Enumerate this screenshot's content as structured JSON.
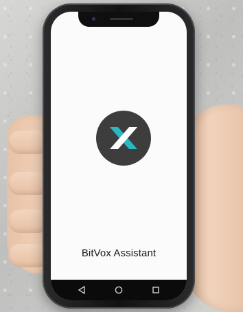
{
  "app": {
    "name": "BitVox Assistant"
  },
  "logo": {
    "icon": "bitvox-x-logo",
    "background": "#3d3d3d",
    "accent_teal": "#2bb7c2",
    "accent_white": "#ffffff"
  },
  "navbar": {
    "buttons": [
      {
        "icon": "back-triangle-icon"
      },
      {
        "icon": "home-circle-icon"
      },
      {
        "icon": "recents-square-icon"
      }
    ]
  }
}
